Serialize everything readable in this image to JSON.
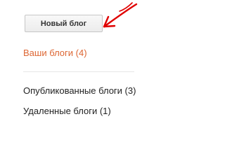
{
  "new_blog_button": {
    "label": "Новый блог"
  },
  "nav": {
    "your_blogs": "Ваши блоги (4)",
    "published": "Опубликованные блоги (3)",
    "deleted": "Удаленные блоги (1)"
  },
  "annotation": {
    "icon": "red-arrow-icon",
    "color": "#e00000"
  },
  "colors": {
    "active_link": "#dd6633",
    "text": "#222222"
  }
}
